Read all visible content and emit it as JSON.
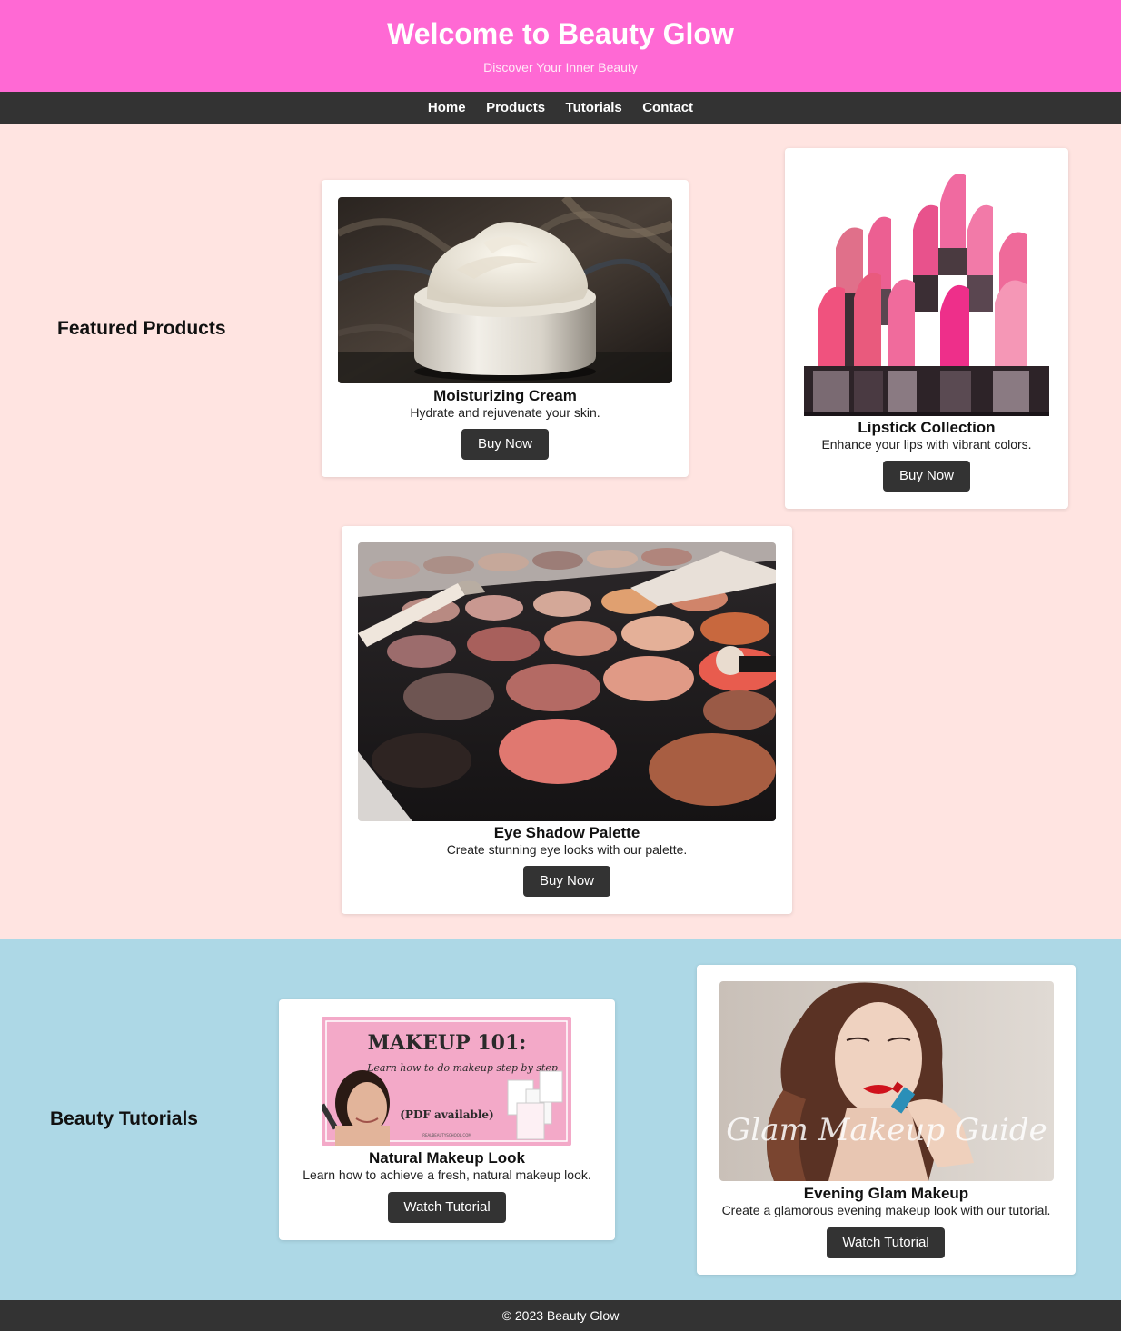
{
  "header": {
    "title": "Welcome to Beauty Glow",
    "subtitle": "Discover Your Inner Beauty"
  },
  "nav": {
    "items": [
      "Home",
      "Products",
      "Tutorials",
      "Contact"
    ]
  },
  "featured": {
    "title": "Featured Products",
    "products": [
      {
        "name": "Moisturizing Cream",
        "description": "Hydrate and rejuvenate your skin.",
        "button": "Buy Now"
      },
      {
        "name": "Lipstick Collection",
        "description": "Enhance your lips with vibrant colors.",
        "button": "Buy Now"
      },
      {
        "name": "Eye Shadow Palette",
        "description": "Create stunning eye looks with our palette.",
        "button": "Buy Now"
      }
    ]
  },
  "tutorials": {
    "title": "Beauty Tutorials",
    "items": [
      {
        "name": "Natural Makeup Look",
        "description": "Learn how to achieve a fresh, natural makeup look.",
        "button": "Watch Tutorial",
        "thumb_heading": "MAKEUP 101:",
        "thumb_script": "Learn how to do makeup step by step",
        "thumb_note": "(PDF available)",
        "thumb_url": "REALBEAUTYSCHOOL.COM"
      },
      {
        "name": "Evening Glam Makeup",
        "description": "Create a glamorous evening makeup look with our tutorial.",
        "button": "Watch Tutorial",
        "thumb_script": "Glam Makeup Guide"
      }
    ]
  },
  "footer": {
    "text": "© 2023 Beauty Glow"
  },
  "colors": {
    "header": "#ff69d4",
    "nav": "#333333",
    "featured_bg": "#ffe4e1",
    "tutorials_bg": "#add8e6",
    "button": "#333333"
  }
}
